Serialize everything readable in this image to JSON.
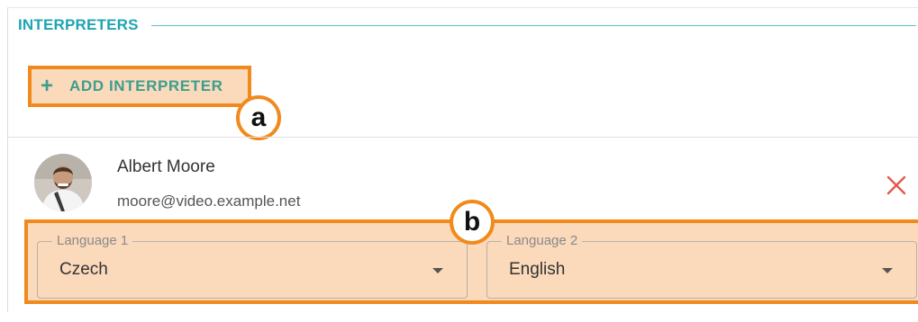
{
  "section": {
    "title": "INTERPRETERS"
  },
  "add_button": {
    "icon": "plus-icon",
    "label": "ADD INTERPRETER"
  },
  "markers": {
    "a": "a",
    "b": "b"
  },
  "interpreter": {
    "name": "Albert Moore",
    "email": "moore@video.example.net",
    "remove_icon": "close-icon",
    "languages": [
      {
        "label": "Language 1",
        "value": "Czech"
      },
      {
        "label": "Language 2",
        "value": "English"
      }
    ]
  },
  "colors": {
    "accent_teal": "#1ea4b2",
    "button_text": "#3d9e8e",
    "highlight_orange": "#f08a1c",
    "highlight_fill": "#fbd9bb",
    "remove_red": "#e05a4f"
  }
}
